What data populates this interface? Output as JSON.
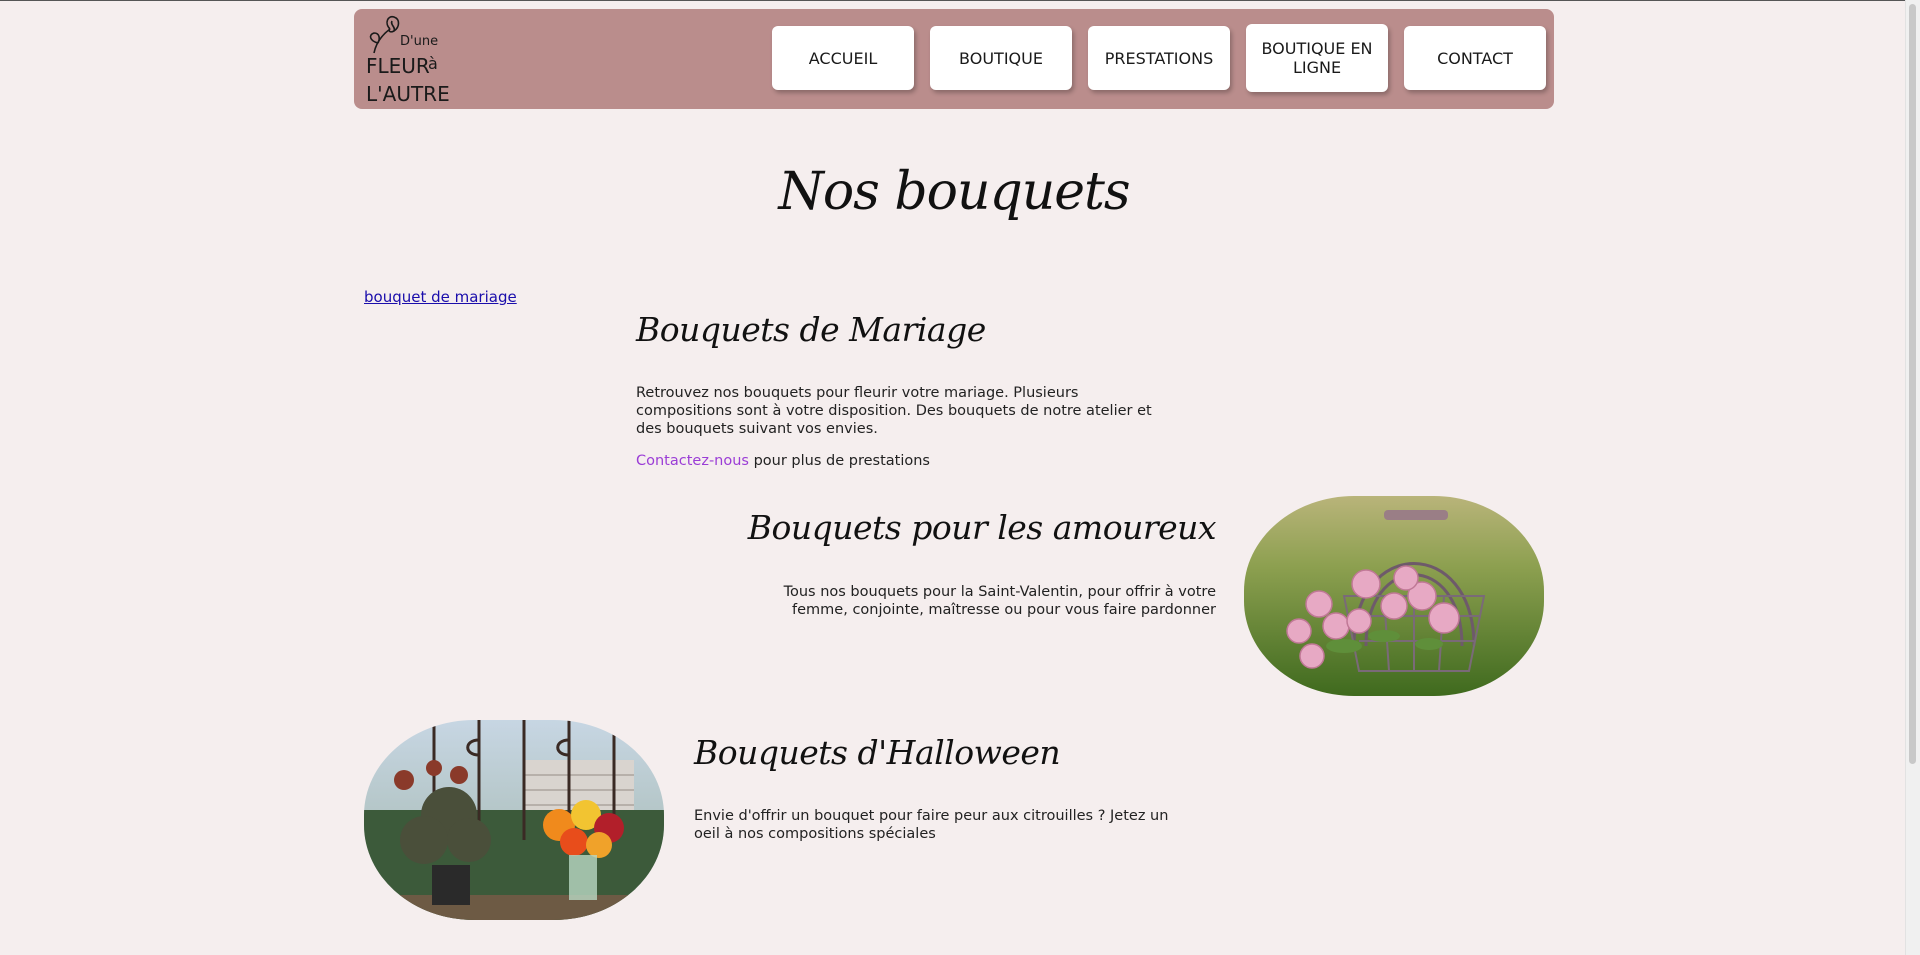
{
  "header": {
    "logo_alt": "D'une Fleur à l'Autre",
    "logo_lines": [
      "D'une",
      "FLEUR à",
      "L'AUTRE"
    ],
    "nav": [
      {
        "label": "ACCUEIL"
      },
      {
        "label": "BOUTIQUE"
      },
      {
        "label": "PRESTATIONS"
      },
      {
        "label": "BOUTIQUE EN LIGNE"
      },
      {
        "label": "CONTACT"
      }
    ]
  },
  "main": {
    "title": "Nos bouquets",
    "side_link": "bouquet de mariage",
    "sections": [
      {
        "heading": "Bouquets de Mariage",
        "text": "Retrouvez nos bouquets pour fleurir votre mariage. Plusieurs compositions sont à votre disposition. Des bouquets de notre atelier et des bouquets suivant vos envies.",
        "contact_link": "Contactez-nous",
        "contact_suffix": " pour plus de prestations"
      },
      {
        "heading": "Bouquets pour les amoureux",
        "text": "Tous nos bouquets pour la Saint-Valentin, pour offrir à votre femme, conjointe, maîtresse ou pour vous faire pardonner",
        "image": "rose-basket-photo"
      },
      {
        "heading": "Bouquets d'Halloween",
        "text": "Envie d'offrir un bouquet pour faire peur aux citrouilles ? Jetez un oeil à nos compositions spéciales",
        "image": "halloween-bouquet-photo"
      }
    ]
  },
  "colors": {
    "page_bg": "#f5eeee",
    "header_bg": "#ba8d8c",
    "link": "#1a0dab",
    "accent_link": "#9b3dd6"
  }
}
